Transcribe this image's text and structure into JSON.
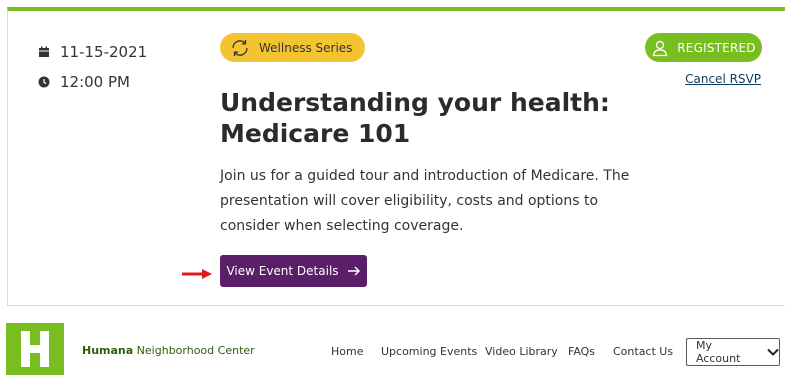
{
  "event": {
    "date": "11-15-2021",
    "time": "12:00 PM",
    "series_label": "Wellness Series",
    "status_label": "REGISTERED",
    "cancel_label": "Cancel RSVP",
    "title_line1": "Understanding your health:",
    "title_line2": "Medicare 101",
    "description": "Join us for a guided tour and introduction of Medicare. The presentation will cover eligibility, costs and options to consider when selecting coverage.",
    "details_button": "View Event Details"
  },
  "footer": {
    "brand_strong": "Humana",
    "brand_rest": " Neighborhood Center",
    "nav": {
      "home": "Home",
      "upcoming": "Upcoming Events",
      "video": "Video Library",
      "faqs": "FAQs",
      "contact": "Contact Us"
    },
    "account_label": "My Account"
  },
  "colors": {
    "accent_green": "#78be20",
    "series_yellow": "#f4c430",
    "button_purple": "#5b1f69",
    "marker_red": "#e01b1b"
  },
  "icons": {
    "date": "calendar-icon",
    "time": "clock-icon",
    "series": "refresh-icon",
    "status": "user-icon",
    "button": "arrow-right-icon",
    "marker": "red-arrow-icon",
    "account": "chevron-down-icon"
  }
}
